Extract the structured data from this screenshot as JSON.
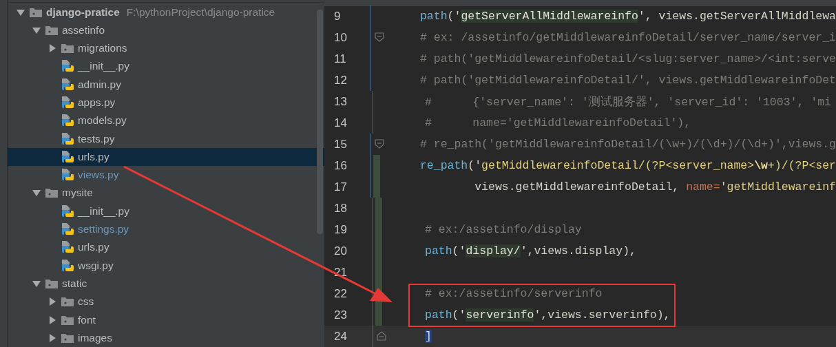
{
  "project_tree": {
    "root": {
      "name": "django-pratice",
      "path": "F:\\pythonProject\\django-pratice",
      "kind": "project",
      "expanded": true,
      "selected": false,
      "children": [
        {
          "name": "assetinfo",
          "kind": "folder",
          "expanded": true,
          "selected": false,
          "children": [
            {
              "name": "migrations",
              "kind": "folder",
              "expanded": false,
              "selected": false
            },
            {
              "name": "__init__.py",
              "kind": "file",
              "modified": false,
              "selected": false
            },
            {
              "name": "admin.py",
              "kind": "file",
              "modified": false,
              "selected": false
            },
            {
              "name": "apps.py",
              "kind": "file",
              "modified": false,
              "selected": false
            },
            {
              "name": "models.py",
              "kind": "file",
              "modified": false,
              "selected": false
            },
            {
              "name": "tests.py",
              "kind": "file",
              "modified": false,
              "selected": false
            },
            {
              "name": "urls.py",
              "kind": "file",
              "modified": false,
              "selected": true
            },
            {
              "name": "views.py",
              "kind": "file",
              "modified": true,
              "selected": false
            }
          ]
        },
        {
          "name": "mysite",
          "kind": "folder",
          "expanded": true,
          "selected": false,
          "children": [
            {
              "name": "__init__.py",
              "kind": "file",
              "modified": false,
              "selected": false
            },
            {
              "name": "settings.py",
              "kind": "file",
              "modified": true,
              "selected": false
            },
            {
              "name": "urls.py",
              "kind": "file",
              "modified": false,
              "selected": false
            },
            {
              "name": "wsgi.py",
              "kind": "file",
              "modified": false,
              "selected": false
            }
          ]
        },
        {
          "name": "static",
          "kind": "folder",
          "expanded": true,
          "selected": false,
          "children": [
            {
              "name": "css",
              "kind": "folder",
              "expanded": false,
              "selected": false
            },
            {
              "name": "font",
              "kind": "folder",
              "expanded": false,
              "selected": false
            },
            {
              "name": "images",
              "kind": "folder",
              "expanded": false,
              "selected": false
            }
          ]
        }
      ]
    }
  },
  "editor": {
    "lines": [
      {
        "number": "9",
        "current": false,
        "changed": false,
        "tokens": [
          {
            "kind": "func",
            "text": "path"
          },
          {
            "kind": "plain",
            "text": "('"
          },
          {
            "kind": "string",
            "text": "getServerAllMiddlewareinfo"
          },
          {
            "kind": "plain",
            "text": "', views.getServerAllMiddlewa"
          }
        ]
      },
      {
        "number": "10",
        "current": false,
        "changed": false,
        "kind": "fold-start",
        "tokens": [
          {
            "kind": "comment",
            "text": "# ex: /assetinfo/getMiddlewareinfoDetail/server_name/server_i"
          }
        ]
      },
      {
        "number": "11",
        "current": false,
        "changed": false,
        "tokens": [
          {
            "kind": "comment",
            "text": "# path('getMiddlewareinfoDetail/<slug:server_name>/<int:serve"
          }
        ]
      },
      {
        "number": "12",
        "current": false,
        "changed": false,
        "tokens": [
          {
            "kind": "comment",
            "text": "# path('getMiddlewareinfoDetail/', views.getMiddlewareinfoDet"
          }
        ]
      },
      {
        "number": "13",
        "current": false,
        "changed": false,
        "tokens": [
          {
            "kind": "comment",
            "text": "#      {'server_name': '测试服务器', 'server_id': '1003', 'mi"
          }
        ]
      },
      {
        "number": "14",
        "current": false,
        "changed": false,
        "tokens": [
          {
            "kind": "comment",
            "text": "#      name='getMiddlewareinfoDetail'),"
          }
        ]
      },
      {
        "number": "15",
        "current": false,
        "changed": false,
        "kind": "fold-start",
        "tokens": [
          {
            "kind": "comment",
            "text": "# re_path('getMiddlewareinfoDetail/(\\w+)/(\\d+)/(\\d+)',views.g"
          }
        ]
      },
      {
        "number": "16",
        "current": false,
        "changed": true,
        "tokens": [
          {
            "kind": "func",
            "text": "re_path"
          },
          {
            "kind": "plain",
            "text": "('"
          },
          {
            "kind": "regex",
            "text": "getMiddlewareinfoDetail/(?P<server_name>"
          },
          {
            "kind": "escape",
            "text": "\\w"
          },
          {
            "kind": "regex",
            "text": "+)/(?P<ser"
          }
        ]
      },
      {
        "number": "17",
        "current": false,
        "changed": true,
        "tokens": [
          {
            "kind": "plain",
            "text": "        views.getMiddlewareinfoDetail, "
          },
          {
            "kind": "kwarg",
            "text": "name="
          },
          {
            "kind": "plain",
            "text": "'"
          },
          {
            "kind": "regex",
            "text": "getMiddlewareinf"
          }
        ]
      },
      {
        "number": "18",
        "current": false,
        "changed": true
      },
      {
        "number": "19",
        "current": false,
        "changed": true,
        "tokens": [
          {
            "kind": "comment",
            "text": "# ex:/assetinfo/display"
          }
        ]
      },
      {
        "number": "20",
        "current": false,
        "changed": true,
        "tokens": [
          {
            "kind": "func",
            "text": "path"
          },
          {
            "kind": "plain",
            "text": "('"
          },
          {
            "kind": "string",
            "text": "display/"
          },
          {
            "kind": "plain",
            "text": "',views.display),"
          }
        ]
      },
      {
        "number": "21",
        "current": false,
        "changed": true
      },
      {
        "number": "22",
        "current": false,
        "changed": true,
        "tokens": [
          {
            "kind": "comment",
            "text": "# ex:/assetinfo/serverinfo"
          }
        ]
      },
      {
        "number": "23",
        "current": false,
        "changed": true,
        "tokens": [
          {
            "kind": "func",
            "text": "path"
          },
          {
            "kind": "plain",
            "text": "('"
          },
          {
            "kind": "string",
            "text": "serverinfo"
          },
          {
            "kind": "plain",
            "text": "',views.serverinfo),"
          }
        ]
      },
      {
        "number": "24",
        "current": true,
        "changed": false,
        "kind": "fold-end",
        "tokens": [
          {
            "kind": "bracket",
            "text": "]"
          }
        ]
      }
    ]
  }
}
